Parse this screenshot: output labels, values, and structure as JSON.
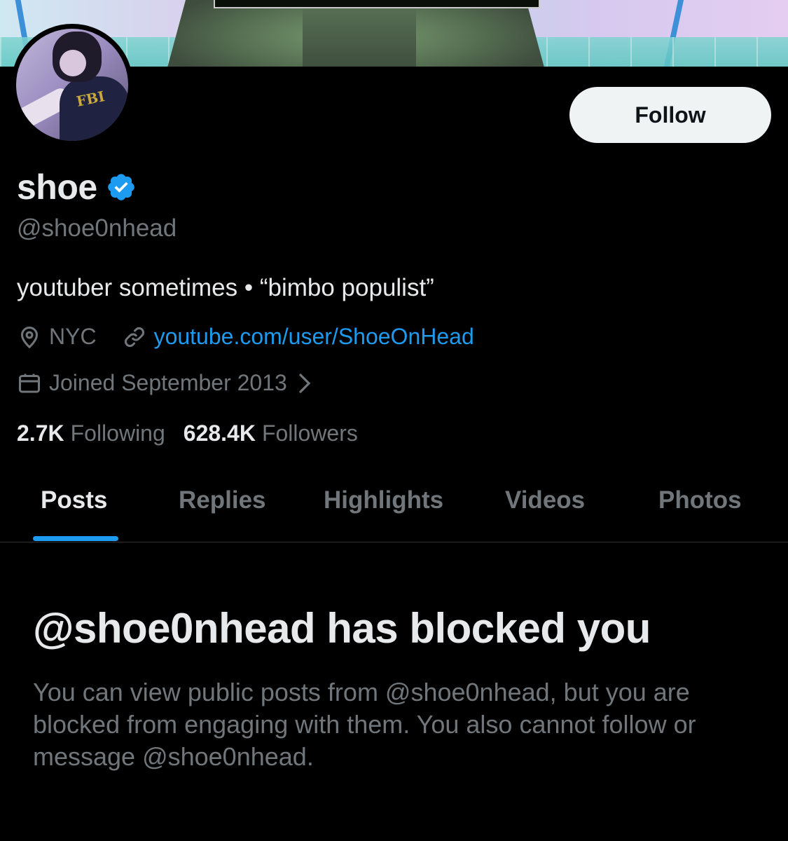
{
  "profile": {
    "display_name": "shoe",
    "handle": "@shoe0nhead",
    "bio": "youtuber sometimes • “bimbo populist”",
    "location": "NYC",
    "website": "youtube.com/user/ShoeOnHead",
    "joined": "Joined September 2013",
    "following_count": "2.7K",
    "following_label": "Following",
    "followers_count": "628.4K",
    "followers_label": "Followers",
    "verified": true
  },
  "actions": {
    "follow_label": "Follow"
  },
  "tabs": [
    {
      "label": "Posts",
      "active": true
    },
    {
      "label": "Replies",
      "active": false
    },
    {
      "label": "Highlights",
      "active": false
    },
    {
      "label": "Videos",
      "active": false
    },
    {
      "label": "Photos",
      "active": false
    }
  ],
  "blocked": {
    "title": "@shoe0nhead has blocked you",
    "description": "You can view public posts from @shoe0nhead, but you are blocked from engaging with them. You also cannot follow or message @shoe0nhead."
  },
  "colors": {
    "background": "#000000",
    "accent": "#1d9bf0",
    "secondary_text": "#71767b",
    "primary_text": "#e7e9ea"
  },
  "icons": [
    "verified-badge-icon",
    "location-pin-icon",
    "link-icon",
    "calendar-icon",
    "chevron-right-icon"
  ]
}
